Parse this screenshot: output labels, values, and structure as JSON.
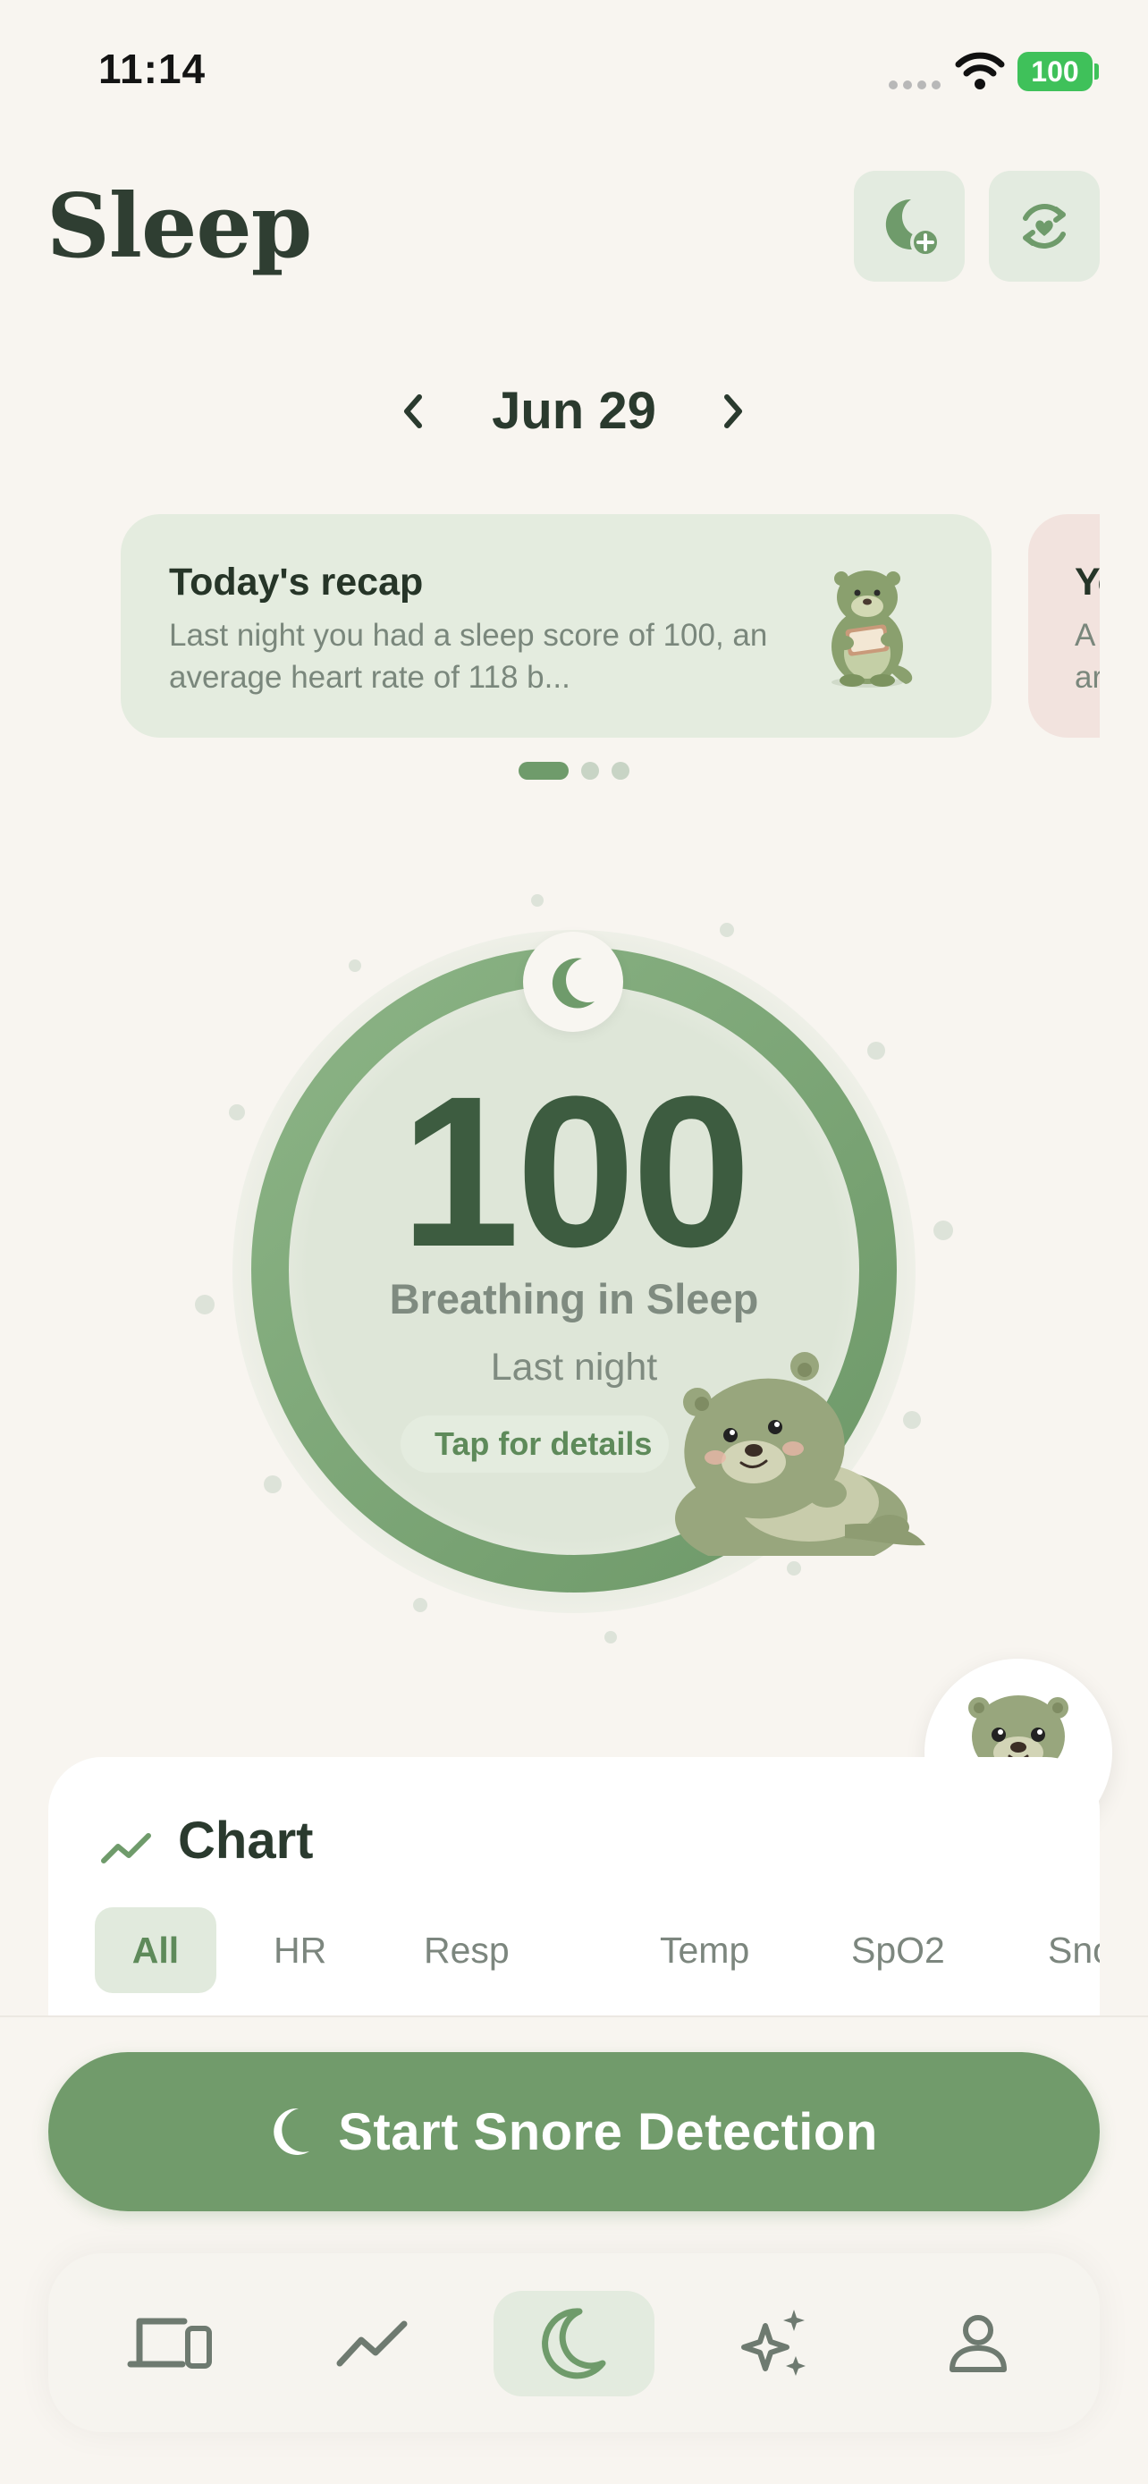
{
  "status_bar": {
    "time": "11:14",
    "battery": "100"
  },
  "header": {
    "title": "Sleep"
  },
  "date_nav": {
    "date": "Jun 29"
  },
  "recap_cards": [
    {
      "title": "Today's recap",
      "body": "Last night you had a sleep score of 100, an average heart rate of 118 b..."
    },
    {
      "title": "Yo",
      "body": "A\nar"
    }
  ],
  "score_ring": {
    "score": "100",
    "metric": "Breathing in Sleep",
    "period": "Last night",
    "details_label": "Tap for details"
  },
  "chart": {
    "heading": "Chart",
    "tabs": [
      "All",
      "HR",
      "Resp",
      "Temp",
      "SpO2",
      "Sno"
    ],
    "selected_tab": "All"
  },
  "cta": {
    "label": "Start Snore Detection"
  },
  "bottom_nav": {
    "items": [
      "devices-icon",
      "trend-icon",
      "sleep-moon-icon",
      "sparkles-icon",
      "profile-icon"
    ],
    "active": "sleep-moon-icon"
  },
  "colors": {
    "accent": "#719b6b",
    "dark_text": "#2f4335",
    "card_bg": "#e4ecdf",
    "page_bg": "#f8f5f0"
  }
}
